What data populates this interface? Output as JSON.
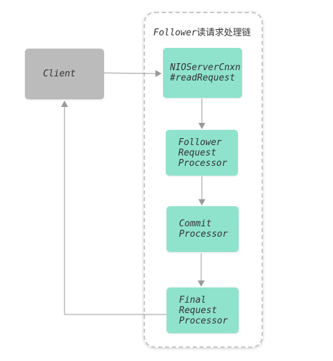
{
  "group": {
    "title_latin": "Follower",
    "title_cn": "读请求处理链"
  },
  "nodes": {
    "client": "Client",
    "nio": "NIOServerCnxn\n#readRequest",
    "follower": "Follower\nRequest\nProcessor",
    "commit": "Commit\nProcessor",
    "final": "Final\nRequest\nProcessor"
  },
  "colors": {
    "processor_fill": "#8fe3cd",
    "client_fill": "#bbbbbb",
    "edge": "#999999",
    "group_border": "#c8c8c8"
  }
}
